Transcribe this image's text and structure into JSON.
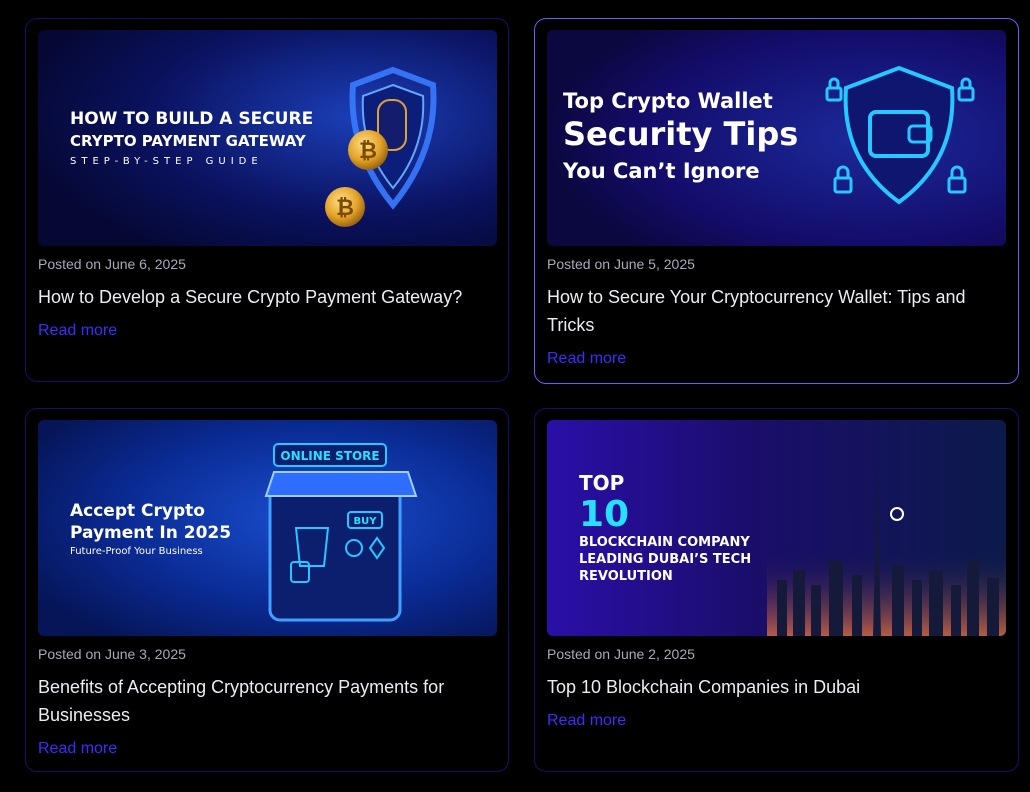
{
  "colors": {
    "link": "#3f2bff",
    "card_border": "#15106a",
    "active_border": "#6a5cff"
  },
  "posts": [
    {
      "date": "Posted on June 6, 2025",
      "title": "How to Develop a Secure Crypto Payment Gateway?",
      "read_more": "Read more",
      "image": {
        "line1": "HOW TO BUILD A SECURE",
        "line2": "CRYPTO PAYMENT GATEWAY",
        "line3": "STEP-BY-STEP GUIDE"
      }
    },
    {
      "date": "Posted on June 5, 2025",
      "title": "How to Secure Your Cryptocurrency Wallet: Tips and Tricks",
      "read_more": "Read more",
      "image": {
        "line1": "Top Crypto Wallet",
        "line2": "Security Tips",
        "line3": "You Can’t Ignore"
      }
    },
    {
      "date": "Posted on June 3, 2025",
      "title": "Benefits of Accepting Cryptocurrency Payments for Businesses",
      "read_more": "Read more",
      "image": {
        "line1": "Accept Crypto",
        "line2": "Payment In 2025",
        "line3": "Future-Proof Your Business",
        "sign": "ONLINE STORE",
        "buy": "BUY"
      }
    },
    {
      "date": "Posted on June 2, 2025",
      "title": "Top 10 Blockchain Companies in Dubai",
      "read_more": "Read more",
      "image": {
        "line1": "TOP",
        "line2": "10",
        "line3": "BLOCKCHAIN COMPANY",
        "line4": "LEADING DUBAI’S TECH",
        "line5": "REVOLUTION"
      }
    }
  ]
}
